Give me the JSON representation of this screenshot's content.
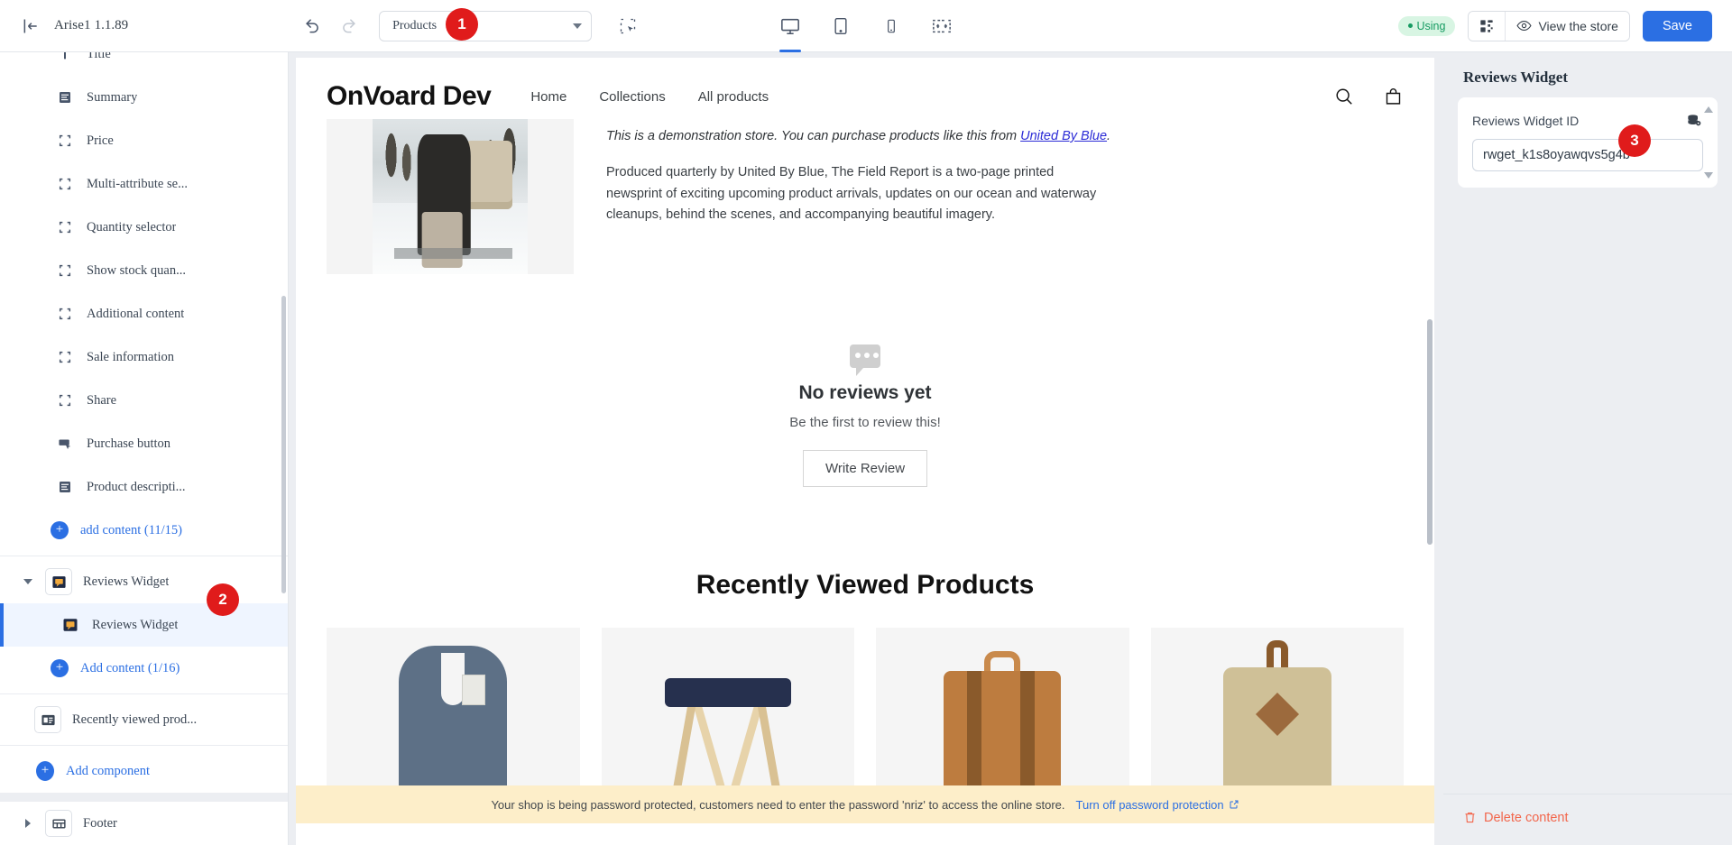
{
  "topbar": {
    "exit_icon": "exit-icon",
    "theme_name": "Arise1",
    "theme_version": "1.1.89",
    "undo_icon": "undo-icon",
    "redo_icon": "redo-icon",
    "page_selector_value": "Products",
    "select_tool_icon": "marquee-select-icon",
    "devices": [
      {
        "name": "desktop",
        "icon": "desktop-icon",
        "active": true
      },
      {
        "name": "tablet",
        "icon": "tablet-icon",
        "active": false
      },
      {
        "name": "mobile",
        "icon": "mobile-icon",
        "active": false
      },
      {
        "name": "fullwidth",
        "icon": "fullwidth-icon",
        "active": false
      }
    ],
    "using_label": "Using",
    "qr_icon": "qr-code-icon",
    "view_store_label": "View the store",
    "view_store_icon": "eye-icon",
    "save_label": "Save"
  },
  "sidebar": {
    "product_items": [
      {
        "label": "Title",
        "icon": "title-icon"
      },
      {
        "label": "Summary",
        "icon": "summary-icon"
      },
      {
        "label": "Price",
        "icon": "block-icon"
      },
      {
        "label": "Multi-attribute se...",
        "icon": "block-icon"
      },
      {
        "label": "Quantity selector",
        "icon": "block-icon"
      },
      {
        "label": "Show stock quan...",
        "icon": "block-icon"
      },
      {
        "label": "Additional content",
        "icon": "block-icon"
      },
      {
        "label": "Sale information",
        "icon": "block-icon"
      },
      {
        "label": "Share",
        "icon": "block-icon"
      },
      {
        "label": "Purchase button",
        "icon": "purchase-button-icon"
      },
      {
        "label": "Product descripti...",
        "icon": "summary-icon"
      }
    ],
    "add_content_product": "add content (11/15)",
    "reviews_component": {
      "label": "Reviews Widget",
      "icon": "reviews-widget-icon",
      "child_label": "Reviews Widget",
      "child_icon": "reviews-widget-icon",
      "add_content": "Add content (1/16)"
    },
    "recently_viewed": {
      "label": "Recently viewed prod...",
      "icon": "recently-viewed-icon"
    },
    "add_component": "Add component",
    "footer": {
      "label": "Footer",
      "icon": "footer-icon"
    }
  },
  "store": {
    "logo": "OnVoard Dev",
    "nav": [
      "Home",
      "Collections",
      "All products"
    ],
    "search_icon": "search-icon",
    "cart_icon": "cart-icon",
    "demo_note_prefix": "This is a demonstration store. You can purchase products like this from ",
    "demo_note_link": "United By Blue",
    "demo_note_suffix": ".",
    "description": "Produced quarterly by United By Blue, The Field Report is a two-page printed newsprint of exciting upcoming product arrivals, updates on our ocean and waterway cleanups, behind the scenes, and accompanying beautiful imagery.",
    "reviews": {
      "icon": "chat-bubble-icon",
      "title": "No reviews yet",
      "subtitle": "Be the first to review this!",
      "button": "Write Review"
    },
    "recently_viewed_title": "Recently Viewed Products",
    "recently_viewed_products": [
      {
        "name": "chambray-shirt"
      },
      {
        "name": "camp-stool"
      },
      {
        "name": "leather-backpack"
      },
      {
        "name": "canvas-duffle"
      }
    ],
    "password_banner": {
      "text": "Your shop is being password protected, customers need to enter the password 'nriz' to access the online store.",
      "link": "Turn off password protection",
      "link_icon": "external-link-icon"
    }
  },
  "right_panel": {
    "title": "Reviews Widget",
    "field_label": "Reviews Widget ID",
    "field_value": "rwget_k1s8oyawqvs5g4b",
    "field_icon": "data-source-icon",
    "delete_label": "Delete content",
    "delete_icon": "trash-icon"
  },
  "badges": [
    {
      "id": "1",
      "label": "1"
    },
    {
      "id": "2",
      "label": "2"
    },
    {
      "id": "3",
      "label": "3"
    }
  ],
  "colors": {
    "accent": "#2b6fe3",
    "badge": "#e01b1b",
    "danger": "#f2674d",
    "using_bg": "#d8f5e3",
    "using_fg": "#169b62",
    "banner_bg": "#fdeec9"
  }
}
